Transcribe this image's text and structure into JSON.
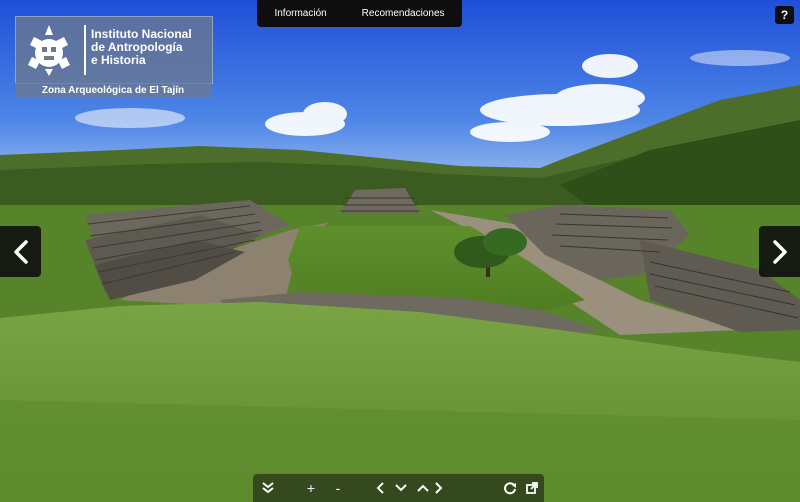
{
  "top_menu": {
    "info_label": "Información",
    "recommendations_label": "Recomendaciones"
  },
  "help": {
    "label": "?"
  },
  "logo": {
    "line1": "Instituto Nacional",
    "line2": "de Antropología",
    "line3": "e Historia",
    "site_name": "Zona Arqueológica de El Tajín"
  },
  "navigation": {
    "prev_icon": "chevron-left-icon",
    "next_icon": "chevron-right-icon"
  },
  "controls": {
    "collapse_icon": "double-chevron-down-icon",
    "zoom_in_label": "+",
    "zoom_out_label": "-",
    "left_icon": "chevron-left-icon",
    "down_icon": "chevron-down-icon",
    "up_icon": "chevron-up-icon",
    "right_icon": "chevron-right-icon",
    "autorotate_icon": "rotate-icon",
    "fullscreen_icon": "fullscreen-icon"
  },
  "colors": {
    "sky_top": "#1f4fd8",
    "sky_bottom": "#8fb6ea",
    "grass": "#6f9a3a",
    "stone": "#6b675d",
    "bar": "#0e0e0e"
  }
}
